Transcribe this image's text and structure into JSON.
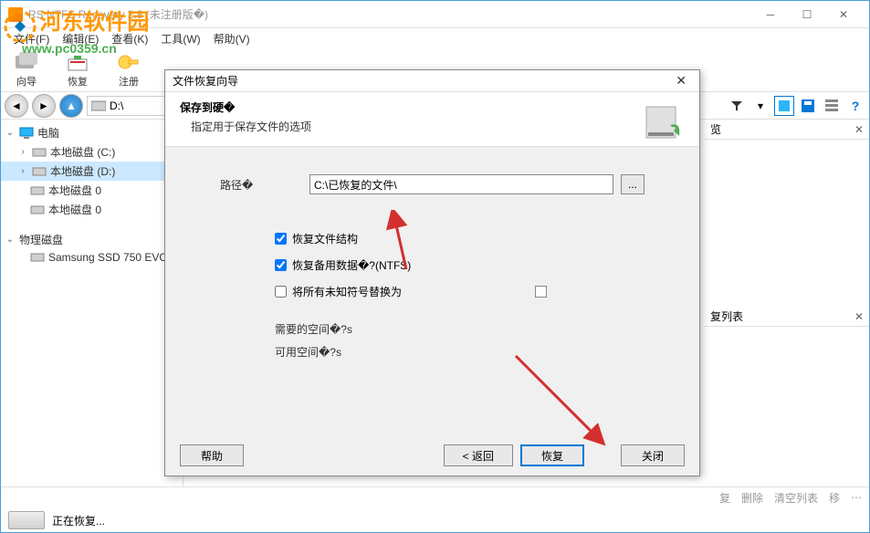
{
  "titlebar": {
    "title": "RS NTFS Recovery 2.8 (未注册版�)"
  },
  "menu": {
    "file": "文件(F)",
    "edit": "编辑(E)",
    "view": "查看(K)",
    "tools": "工具(W)",
    "help": "帮助(V)"
  },
  "toolbar": {
    "wizard": "向导",
    "recover": "恢复",
    "register": "注册"
  },
  "navbar": {
    "path": "D:\\"
  },
  "sidebar": {
    "computer": "电脑",
    "disk_c": "本地磁盘 (C:)",
    "disk_d": "本地磁盘 (D:)",
    "disk_0a": "本地磁盘 0",
    "disk_0b": "本地磁盘 0",
    "physical": "物理磁盘",
    "ssd": "Samsung SSD 750 EVO"
  },
  "right_panel": {
    "preview": "览",
    "recovery_list": "复列表"
  },
  "status": {
    "recover": "复",
    "delete": "删除",
    "clear": "清空列表",
    "folder": "移",
    "recovering": "正在恢复..."
  },
  "dialog": {
    "title": "文件恢复向导",
    "header_title": "保存到硬�",
    "header_sub": "指定用于保存文件的选项",
    "path_label": "路径�",
    "path_value": "C:\\已恢复的文件\\",
    "browse": "...",
    "cb_structure": "恢复文件结构",
    "cb_backup": "恢复备用数据�?(NTFS)",
    "cb_replace": "将所有未知符号替换为",
    "space_needed": "需要的空间�?s",
    "space_avail": "可用空间�?s",
    "help": "帮助",
    "back": "< 返回",
    "next": "恢复",
    "close": "关闭"
  },
  "watermark": {
    "line1": "河东软件园",
    "line2": "www.pc0359.cn"
  }
}
